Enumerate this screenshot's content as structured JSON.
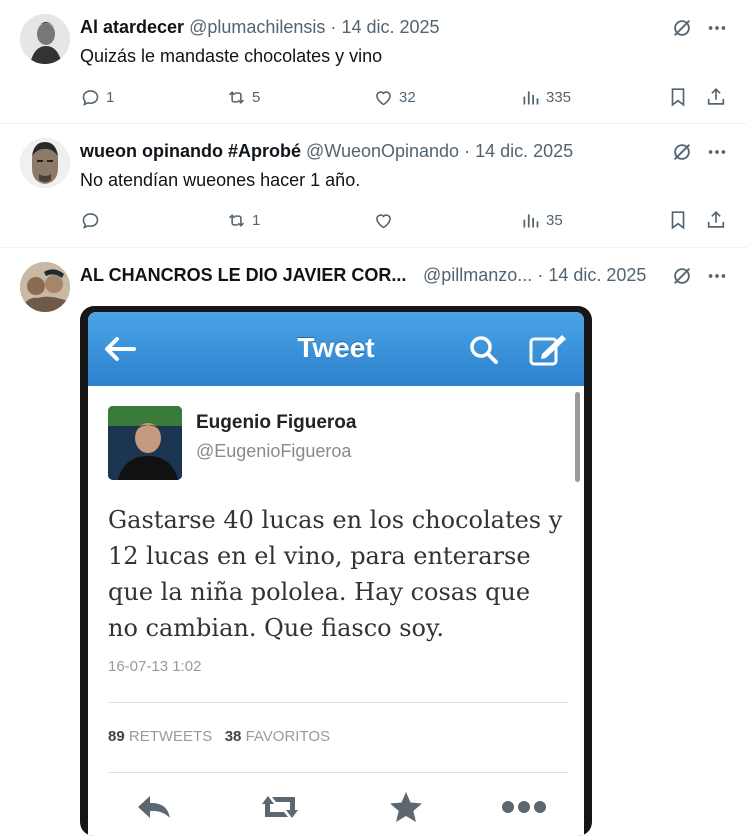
{
  "posts": [
    {
      "name": "Al atardecer",
      "handle": "@plumachilensis",
      "date": "14 dic. 2025",
      "text": "Quizás le mandaste chocolates y vino",
      "replies": "1",
      "reposts": "5",
      "likes": "32",
      "views": "335"
    },
    {
      "name": "wueon opinando #Aprobé",
      "handle": "@WueonOpinando",
      "date": "14 dic. 2025",
      "text": "No atendían wueones hacer 1 año.",
      "replies": "",
      "reposts": "1",
      "likes": "",
      "views": "35"
    },
    {
      "name": "AL CHANCROS LE DIO JAVIER COR...",
      "handle": "@pillmanzo...",
      "date": "14 dic. 2025"
    }
  ],
  "dot": "·",
  "embedded": {
    "bar_title": "Tweet",
    "author_name": "Eugenio Figueroa",
    "author_handle": "@EugenioFigueroa",
    "lines": [
      "Gastarse 40 lucas en los chocolates y",
      "12 lucas en el vino, para enterarse",
      "que la niña pololea.  Hay cosas que",
      "no cambian.  Que fiasco soy."
    ],
    "timestamp": "16-07-13 1:02",
    "retweets_count": "89",
    "retweets_label": "RETWEETS",
    "favorites_count": "38",
    "favorites_label": "FAVORITOS"
  },
  "icons": {
    "reply": "reply-icon",
    "repost": "repost-icon",
    "like": "heart-icon",
    "views": "views-icon",
    "bookmark": "bookmark-icon",
    "share": "share-icon",
    "grok": "grok-icon",
    "more": "more-icon"
  },
  "colors": {
    "secondary_text": "#536471",
    "tweet_bar": "#2c82cd"
  }
}
